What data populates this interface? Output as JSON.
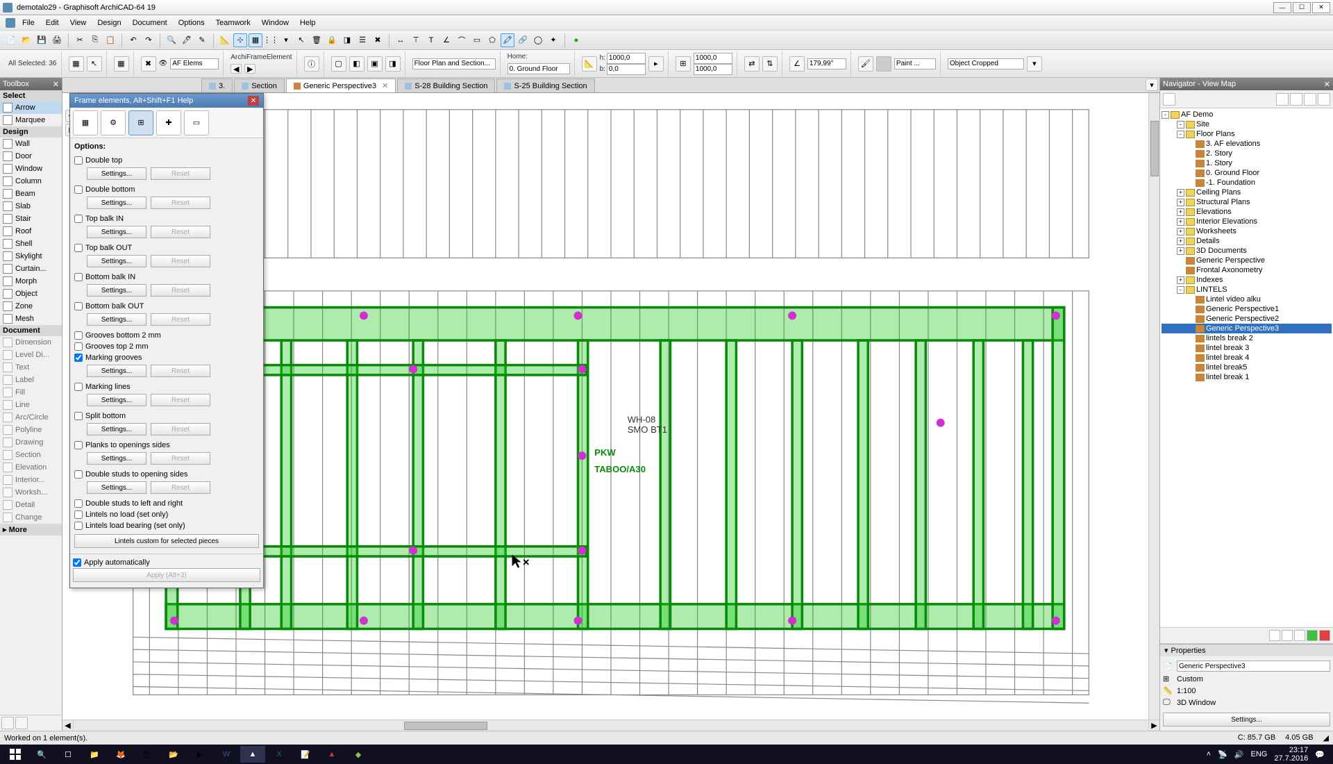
{
  "title": "demotalo29 - Graphisoft ArchiCAD-64 19",
  "menu": [
    "File",
    "Edit",
    "View",
    "Design",
    "Document",
    "Options",
    "Teamwork",
    "Window",
    "Help"
  ],
  "selection_status": "All Selected: 36",
  "infobox": {
    "element_type": "ArchiFrameElement",
    "layer": "AF Elems",
    "floor_link": "Floor Plan and Section...",
    "home_label": "Home:",
    "home_story": "0. Ground Floor",
    "h_label": "h:",
    "h_value": "1000,0",
    "b_label": "b:",
    "b_value": "0,0",
    "dim1": "1000,0",
    "dim2": "1000,0",
    "angle": "179,99°",
    "paint": "Paint ...",
    "crop": "Object Cropped"
  },
  "toolbox": {
    "title": "Toolbox",
    "select_hdr": "Select",
    "arrow": "Arrow",
    "marquee": "Marquee",
    "design_hdr": "Design",
    "design": [
      "Wall",
      "Door",
      "Window",
      "Column",
      "Beam",
      "Slab",
      "Stair",
      "Roof",
      "Shell",
      "Skylight",
      "Curtain...",
      "Morph",
      "Object",
      "Zone",
      "Mesh"
    ],
    "document_hdr": "Document",
    "document": [
      "Dimension",
      "Level Di...",
      "Text",
      "Label",
      "Fill",
      "Line",
      "Arc/Circle",
      "Polyline",
      "Drawing",
      "Section",
      "Elevation",
      "Interior...",
      "Worksh...",
      "Detail",
      "Change"
    ],
    "more": "More"
  },
  "dialog": {
    "title": "Frame elements, Alt+Shift+F1 Help",
    "options_hdr": "Options:",
    "settings_btn": "Settings...",
    "reset_btn": "Reset",
    "opts": [
      {
        "label": "Double top",
        "checked": false,
        "btns": true
      },
      {
        "label": "Double bottom",
        "checked": false,
        "btns": true
      },
      {
        "label": "Top balk IN",
        "checked": false,
        "btns": true
      },
      {
        "label": "Top balk OUT",
        "checked": false,
        "btns": true
      },
      {
        "label": "Bottom balk IN",
        "checked": false,
        "btns": true
      },
      {
        "label": "Bottom balk OUT",
        "checked": false,
        "btns": true
      },
      {
        "label": "Grooves bottom 2 mm",
        "checked": false,
        "btns": false
      },
      {
        "label": "Grooves top 2 mm",
        "checked": false,
        "btns": false
      },
      {
        "label": "Marking grooves",
        "checked": true,
        "btns": true
      },
      {
        "label": "Marking lines",
        "checked": false,
        "btns": true
      },
      {
        "label": "Split bottom",
        "checked": false,
        "btns": true
      },
      {
        "label": "Planks to openings sides",
        "checked": false,
        "btns": true
      },
      {
        "label": "Double studs to opening sides",
        "checked": false,
        "btns": true
      },
      {
        "label": "Double studs to left and right",
        "checked": false,
        "btns": false
      },
      {
        "label": "Lintels no load (set only)",
        "checked": false,
        "btns": false
      },
      {
        "label": "Lintels load bearing (set only)",
        "checked": false,
        "btns": false
      }
    ],
    "custom_btn": "Lintels custom for selected pieces",
    "apply_auto": "Apply automatically",
    "apply_btn": "Apply (Alt+3)"
  },
  "tabs": [
    {
      "label": "3.",
      "icon": "plan"
    },
    {
      "label": "Section",
      "icon": "section"
    },
    {
      "label": "Generic Perspective3",
      "icon": "3d",
      "active": true,
      "close": true
    },
    {
      "label": "S-28 Building Section",
      "icon": "section"
    },
    {
      "label": "S-25 Building Section",
      "icon": "section"
    }
  ],
  "navigator": {
    "title": "Navigator - View Map",
    "root": "AF Demo",
    "tree": [
      {
        "d": 1,
        "ex": "-",
        "ic": "folder",
        "label": "Site"
      },
      {
        "d": 1,
        "ex": "-",
        "ic": "folder",
        "label": "Floor Plans"
      },
      {
        "d": 2,
        "ex": "",
        "ic": "view",
        "label": "3. AF elevations"
      },
      {
        "d": 2,
        "ex": "",
        "ic": "view",
        "label": "2. Story"
      },
      {
        "d": 2,
        "ex": "",
        "ic": "view",
        "label": "1. Story"
      },
      {
        "d": 2,
        "ex": "",
        "ic": "view",
        "label": "0. Ground Floor"
      },
      {
        "d": 2,
        "ex": "",
        "ic": "view",
        "label": "-1. Foundation"
      },
      {
        "d": 1,
        "ex": "+",
        "ic": "folder",
        "label": "Ceiling Plans"
      },
      {
        "d": 1,
        "ex": "+",
        "ic": "folder",
        "label": "Structural Plans"
      },
      {
        "d": 1,
        "ex": "+",
        "ic": "folder",
        "label": "Elevations"
      },
      {
        "d": 1,
        "ex": "+",
        "ic": "folder",
        "label": "Interior Elevations"
      },
      {
        "d": 1,
        "ex": "+",
        "ic": "folder",
        "label": "Worksheets"
      },
      {
        "d": 1,
        "ex": "+",
        "ic": "folder",
        "label": "Details"
      },
      {
        "d": 1,
        "ex": "+",
        "ic": "folder",
        "label": "3D Documents"
      },
      {
        "d": 1,
        "ex": "",
        "ic": "view",
        "label": "Generic Perspective"
      },
      {
        "d": 1,
        "ex": "",
        "ic": "view",
        "label": "Frontal Axonometry"
      },
      {
        "d": 1,
        "ex": "+",
        "ic": "folder",
        "label": "Indexes"
      },
      {
        "d": 1,
        "ex": "-",
        "ic": "folder",
        "label": "LINTELS"
      },
      {
        "d": 2,
        "ex": "",
        "ic": "view",
        "label": "Lintel video alku"
      },
      {
        "d": 2,
        "ex": "",
        "ic": "view",
        "label": "Generic Perspective1"
      },
      {
        "d": 2,
        "ex": "",
        "ic": "view",
        "label": "Generic Perspective2"
      },
      {
        "d": 2,
        "ex": "",
        "ic": "view",
        "label": "Generic Perspective3",
        "sel": true
      },
      {
        "d": 2,
        "ex": "",
        "ic": "view",
        "label": "lintels break 2"
      },
      {
        "d": 2,
        "ex": "",
        "ic": "view",
        "label": "lintel break 3"
      },
      {
        "d": 2,
        "ex": "",
        "ic": "view",
        "label": "lintel break 4"
      },
      {
        "d": 2,
        "ex": "",
        "ic": "view",
        "label": "lintel break5"
      },
      {
        "d": 2,
        "ex": "",
        "ic": "view",
        "label": "lintel break 1"
      }
    ],
    "props_hdr": "Properties",
    "props_name": "Generic Perspective3",
    "props_custom": "Custom",
    "props_scale": "1:100",
    "props_window": "3D Window",
    "settings_btn": "Settings..."
  },
  "status": {
    "msg": "Worked on 1 element(s).",
    "disk": "C: 85.7 GB",
    "mem": "4.05 GB"
  },
  "taskbar": {
    "lang": "ENG",
    "time": "23:17",
    "date": "27.7.2016"
  }
}
